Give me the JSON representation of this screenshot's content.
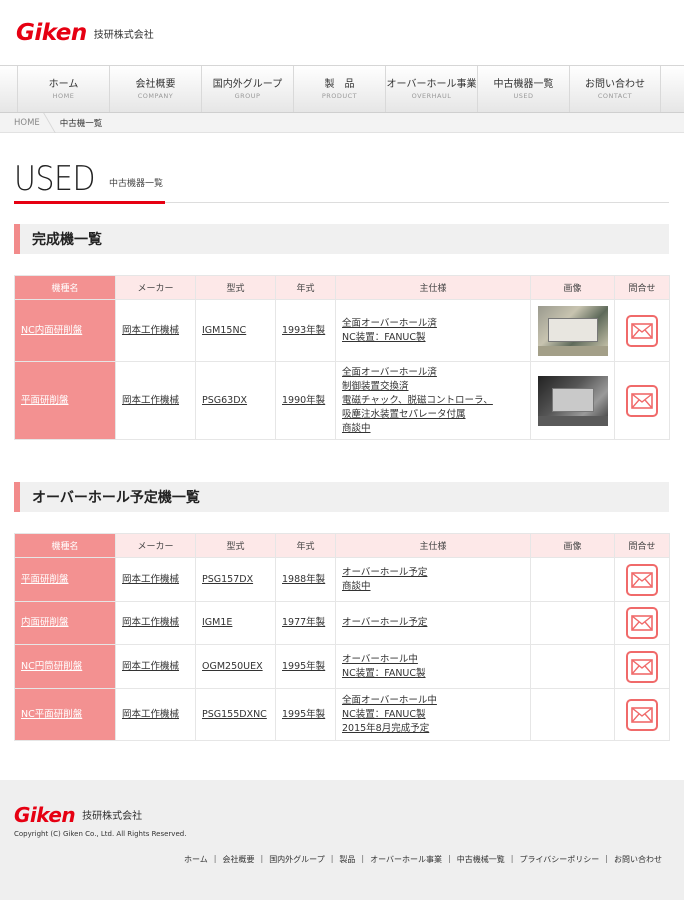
{
  "header": {
    "logo": "Giken",
    "company": "技研株式会社"
  },
  "nav": [
    {
      "jp": "ホーム",
      "en": "HOME"
    },
    {
      "jp": "会社概要",
      "en": "COMPANY"
    },
    {
      "jp": "国内外グループ",
      "en": "GROUP"
    },
    {
      "jp": "製　品",
      "en": "PRODUCT"
    },
    {
      "jp": "オーバーホール事業",
      "en": "OVERHAUL"
    },
    {
      "jp": "中古機器一覧",
      "en": "USED"
    },
    {
      "jp": "お問い合わせ",
      "en": "CONTACT"
    }
  ],
  "breadcrumb": {
    "home": "HOME",
    "current": "中古機一覧"
  },
  "page_title": {
    "en": "USED",
    "jp": "中古機器一覧"
  },
  "columns": [
    "機種名",
    "メーカー",
    "型式",
    "年式",
    "主仕様",
    "画像",
    "問合せ"
  ],
  "section1": {
    "title": "完成機一覧",
    "rows": [
      {
        "name": "NC内面研削盤",
        "maker": "岡本工作機械",
        "model": "IGM15NC",
        "year": "1993年製",
        "spec": [
          "全面オーバーホール済",
          "NC装置：FANUC製"
        ],
        "image": "machine-photo-1"
      },
      {
        "name": "平面研削盤",
        "maker": "岡本工作機械",
        "model": "PSG63DX",
        "year": "1990年製",
        "spec": [
          "全面オーバーホール済",
          "制御装置交換済",
          "電磁チャック、脱磁コントローラ、",
          "吸塵注水装置セパレータ付属",
          "商談中"
        ],
        "image": "machine-photo-2"
      }
    ]
  },
  "section2": {
    "title": "オーバーホール予定機一覧",
    "rows": [
      {
        "name": "平面研削盤",
        "maker": "岡本工作機械",
        "model": "PSG157DX",
        "year": "1988年製",
        "spec": [
          "オーバーホール予定",
          "商談中"
        ]
      },
      {
        "name": "内面研削盤",
        "maker": "岡本工作機械",
        "model": "IGM1E",
        "year": "1977年製",
        "spec": [
          "オーバーホール予定"
        ]
      },
      {
        "name": "NC円筒研削盤",
        "maker": "岡本工作機械",
        "model": "OGM250UEX",
        "year": "1995年製",
        "spec": [
          "オーバーホール中",
          "NC装置：FANUC製"
        ]
      },
      {
        "name": "NC平面研削盤",
        "maker": "岡本工作機械",
        "model": "PSG155DXNC",
        "year": "1995年製",
        "spec": [
          "全面オーバーホール中",
          "NC装置：FANUC製",
          "2015年8月完成予定"
        ]
      }
    ]
  },
  "footer": {
    "logo": "Giken",
    "company": "技研株式会社",
    "copyright": "Copyright (C) Giken Co., Ltd. All Rights Reserved.",
    "links": [
      "ホーム",
      "会社概要",
      "国内外グループ",
      "製品",
      "オーバーホール事業",
      "中古機械一覧",
      "プライバシーポリシー",
      "お問い合わせ"
    ]
  },
  "colors": {
    "brand": "#e60012",
    "name_cell": "#f39191",
    "header_cell": "#fde8e8",
    "mail_icon": "#f06a6a"
  }
}
